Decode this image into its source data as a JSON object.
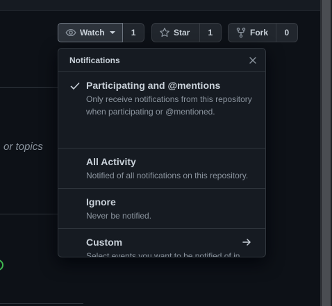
{
  "buttons": {
    "watch": {
      "label": "Watch",
      "count": "1"
    },
    "star": {
      "label": "Star",
      "count": "1"
    },
    "fork": {
      "label": "Fork",
      "count": "0"
    }
  },
  "background": {
    "partial_text": "or topics"
  },
  "notifications_menu": {
    "title": "Notifications",
    "items": [
      {
        "title": "Participating and @mentions",
        "description": "Only receive notifications from this repository when participating or @mentioned.",
        "selected": true
      },
      {
        "title": "All Activity",
        "description": "Notified of all notifications on this repository.",
        "selected": false
      },
      {
        "title": "Ignore",
        "description": "Never be notified.",
        "selected": false
      },
      {
        "title": "Custom",
        "description": "Select events you want to be notified of in addition to participating and @mentions.",
        "selected": false
      }
    ]
  },
  "colors": {
    "background": "#0d1117",
    "menu_background": "#161b22",
    "border": "#30363d",
    "text_primary": "#c9d1d9",
    "text_muted": "#8b949e",
    "success": "#3fb950"
  },
  "icons": {
    "watch": "eye-icon",
    "star": "star-icon",
    "fork": "repo-forked-icon",
    "close": "close-icon",
    "selected": "check-icon",
    "custom": "arrow-right-icon"
  }
}
